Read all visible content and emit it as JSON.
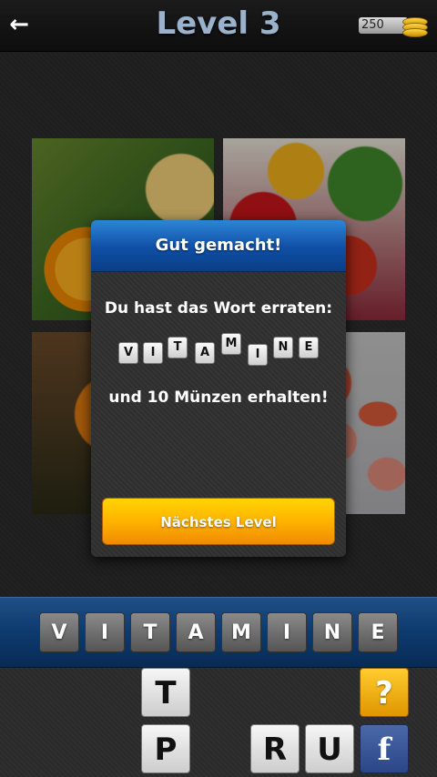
{
  "header": {
    "back_icon": "arrow-left-icon",
    "title": "Level 3",
    "coins": "250",
    "coin_icon": "coin-stack-icon"
  },
  "images": [
    {
      "subject": "orange-juice-photo"
    },
    {
      "subject": "vegetables-photo"
    },
    {
      "subject": "fruits-photo"
    },
    {
      "subject": "pills-photo"
    }
  ],
  "dialog": {
    "title": "Gut gemacht!",
    "message": "Du hast das Wort erraten:",
    "word_letters": [
      "V",
      "I",
      "T",
      "A",
      "M",
      "I",
      "N",
      "E"
    ],
    "reward": "und 10 Münzen erhalten!",
    "next_button": "Nächstes Level",
    "colors": {
      "header": "#0f4fa6",
      "button": "#ffb300"
    }
  },
  "answer": {
    "letters": [
      "V",
      "I",
      "T",
      "A",
      "M",
      "I",
      "N",
      "E"
    ]
  },
  "keyboard": {
    "row1": [
      "T"
    ],
    "row2": [
      "P",
      "R",
      "U"
    ],
    "hint_label": "?",
    "facebook_label": "f"
  }
}
